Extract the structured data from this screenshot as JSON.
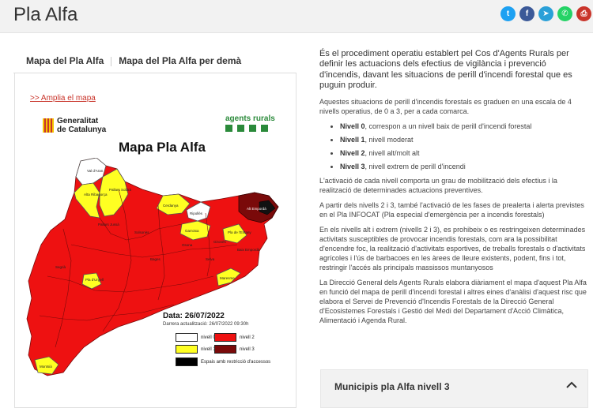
{
  "page": {
    "title": "Pla Alfa"
  },
  "share": [
    {
      "name": "twitter-icon",
      "glyph": "t",
      "color": "#1da1f2"
    },
    {
      "name": "facebook-icon",
      "glyph": "f",
      "color": "#3b5998"
    },
    {
      "name": "telegram-icon",
      "glyph": "➤",
      "color": "#2aa0d8"
    },
    {
      "name": "whatsapp-icon",
      "glyph": "✆",
      "color": "#25d366"
    },
    {
      "name": "print-icon",
      "glyph": "⎙",
      "color": "#c9342a"
    }
  ],
  "tabs": [
    {
      "label": "Mapa del Pla Alfa",
      "active": true
    },
    {
      "label": "Mapa del Pla Alfa per demà",
      "active": false
    }
  ],
  "map": {
    "amplia_link": ">> Amplia el mapa",
    "generalitat_line1": "Generalitat",
    "generalitat_line2": "de Catalunya",
    "agents_rurals": "agents rurals",
    "title": "Mapa Pla Alfa",
    "date": "Data: 26/07/2022",
    "updated": "Darrera actualització: 26/07/2022 09:30h",
    "legend": [
      {
        "label": "nivell 0",
        "color": "#ffffff"
      },
      {
        "label": "nivell 2",
        "color": "#ee1111"
      },
      {
        "label": "nivell 1",
        "color": "#ffff22"
      },
      {
        "label": "nivell 3",
        "color": "#7a0a0a"
      },
      {
        "label": "Espais amb restricció d'accessos",
        "color": "#000000"
      }
    ],
    "region_labels": [
      "Val d'Aran",
      "Alta Ribagorça",
      "Pallars Sobirà",
      "Pallars Jussà",
      "Cerdanya",
      "Ripollès",
      "Alt Empordà",
      "Garrotxa",
      "Pla de l'Estany",
      "Gironès",
      "Baix Empordà",
      "Solsonès",
      "Bages",
      "Osona",
      "Selva",
      "Maresme",
      "Pla d'Urgell",
      "Segrià",
      "Montsià"
    ]
  },
  "content": {
    "lead": "És el procediment operatiu establert pel Cos d'Agents Rurals per definir les actuacions dels efectius de vigilància i prevenció d'incendis, davant les situacions de perill d'incendi forestal que es puguin produir.",
    "p1": "Aquestes situacions de perill d'incendis forestals es graduen en una escala de 4 nivells operatius, de 0 a 3, per a cada comarca.",
    "levels": [
      {
        "name": "Nivell 0",
        "desc": ", correspon a un nivell baix de perill d'incendi forestal"
      },
      {
        "name": "Nivell 1",
        "desc": ", nivell moderat"
      },
      {
        "name": "Nivell 2",
        "desc": ", nivell alt/molt alt"
      },
      {
        "name": "Nivell 3",
        "desc": ", nivell extrem de perill d'incendi"
      }
    ],
    "p2": "L'activació de cada nivell comporta un grau de mobilització dels efectius i la realització de determinades actuacions preventives.",
    "p3": "A partir dels nivells 2 i 3, també l'activació de les fases de prealerta i alerta previstes en el Pla INFOCAT (Pla especial d'emergència per a incendis forestals)",
    "p4": "En els nivells alt i extrem (nivells 2 i 3), es prohibeix o es restringeixen determinades activitats susceptibles de provocar incendis forestals, com ara la possibilitat d'encendre foc, la realització d'activitats esportives, de treballs forestals o d'activitats agrícoles i l'ús de barbacoes en les àrees de lleure existents, podent, fins i tot, restringir l'accés als principals massissos muntanyosos",
    "p5": "La Direcció General dels Agents Rurals elabora diàriament el mapa d'aquest Pla Alfa en funció del mapa de perill d'incendi forestal i altres eines d'anàlisi d'aquest risc que elabora el Servei de Prevenció d'Incendis Forestals de la Direcció General d'Ecosistemes Forestals i Gestió del Medi del Departament d'Acció Climàtica, Alimentació i Agenda Rural."
  },
  "accordion": {
    "title": "Municipis pla Alfa nivell 3",
    "expanded": true
  }
}
